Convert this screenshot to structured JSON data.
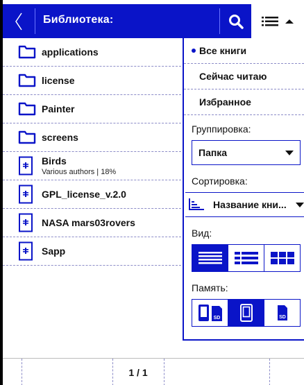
{
  "header": {
    "title": "Библиотека:",
    "back_icon": "chevron-left-icon",
    "search_icon": "search-icon",
    "menu_icon": "list-menu-icon"
  },
  "list": {
    "items": [
      {
        "type": "folder",
        "label": "applications"
      },
      {
        "type": "folder",
        "label": "license"
      },
      {
        "type": "folder",
        "label": "Painter"
      },
      {
        "type": "folder",
        "label": "screens"
      },
      {
        "type": "book",
        "label": "Birds",
        "meta": "Various authors |    18%"
      },
      {
        "type": "book",
        "label": "GPL_license_v.2.0"
      },
      {
        "type": "book",
        "label": "NASA mars03rovers"
      },
      {
        "type": "book",
        "label": "Sapp"
      }
    ]
  },
  "panel": {
    "filters": [
      "Все книги",
      "Сейчас читаю",
      "Избранное"
    ],
    "active_filter": "Все книги",
    "grouping_label": "Группировка:",
    "grouping_value": "Папка",
    "sorting_label": "Сортировка:",
    "sorting_value": "Название кни...",
    "view_label": "Вид:",
    "memory_label": "Память:",
    "memory_sd_label": "SD"
  },
  "footer": {
    "page": "1 / 1"
  },
  "colors": {
    "accent": "#0a14c8",
    "divider": "#8c8cc8"
  }
}
